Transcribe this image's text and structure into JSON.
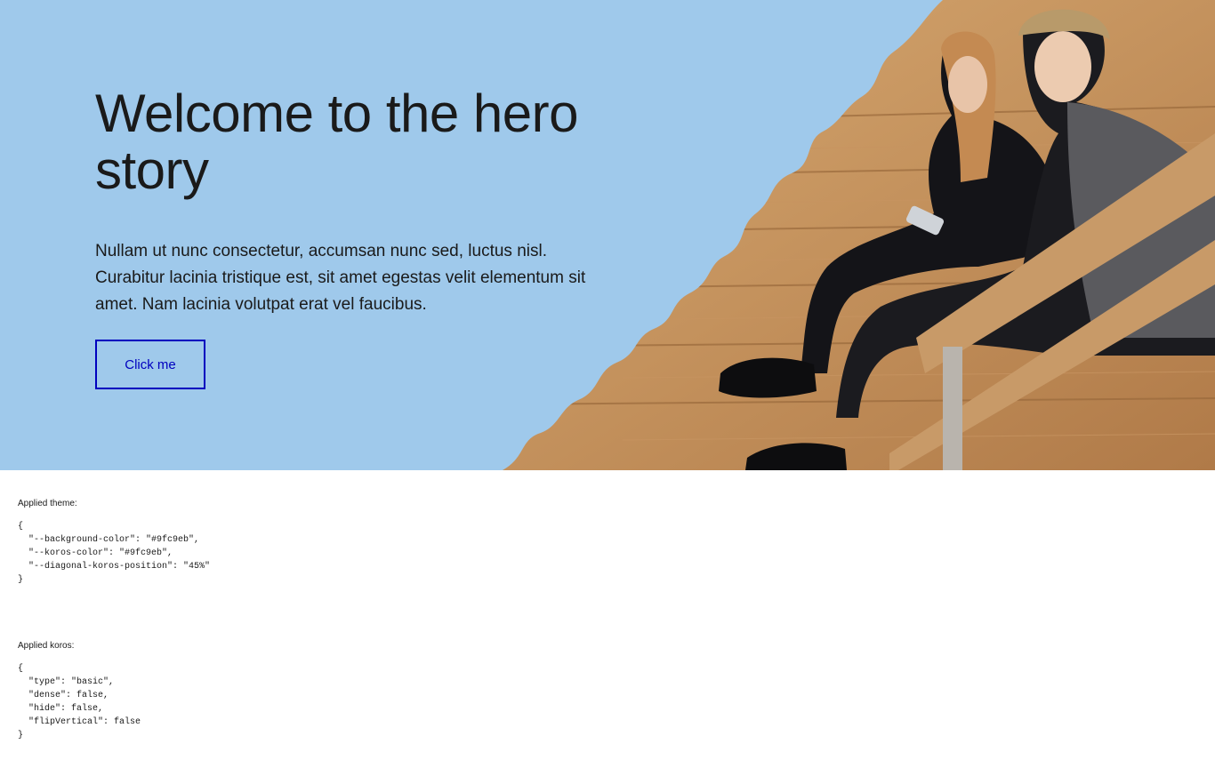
{
  "hero": {
    "title": "Welcome to the hero story",
    "description": "Nullam ut nunc consectetur, accumsan nunc sed, luctus nisl. Curabitur lacinia tristique est, sit amet egestas velit elementum sit amet. Nam lacinia volutpat erat vel faucibus.",
    "button_label": "Click me",
    "image_alt": "Two people sitting on wooden stairs looking at a phone",
    "colors": {
      "background": "#9fc9eb",
      "button": "#0000bf",
      "wood_light": "#c8945e",
      "wood_dark": "#a8703f"
    }
  },
  "theme_section": {
    "label": "Applied theme:",
    "code": "{\n  \"--background-color\": \"#9fc9eb\",\n  \"--koros-color\": \"#9fc9eb\",\n  \"--diagonal-koros-position\": \"45%\"\n}"
  },
  "koros_section": {
    "label": "Applied koros:",
    "code": "{\n  \"type\": \"basic\",\n  \"dense\": false,\n  \"hide\": false,\n  \"flipVertical\": false\n}"
  }
}
